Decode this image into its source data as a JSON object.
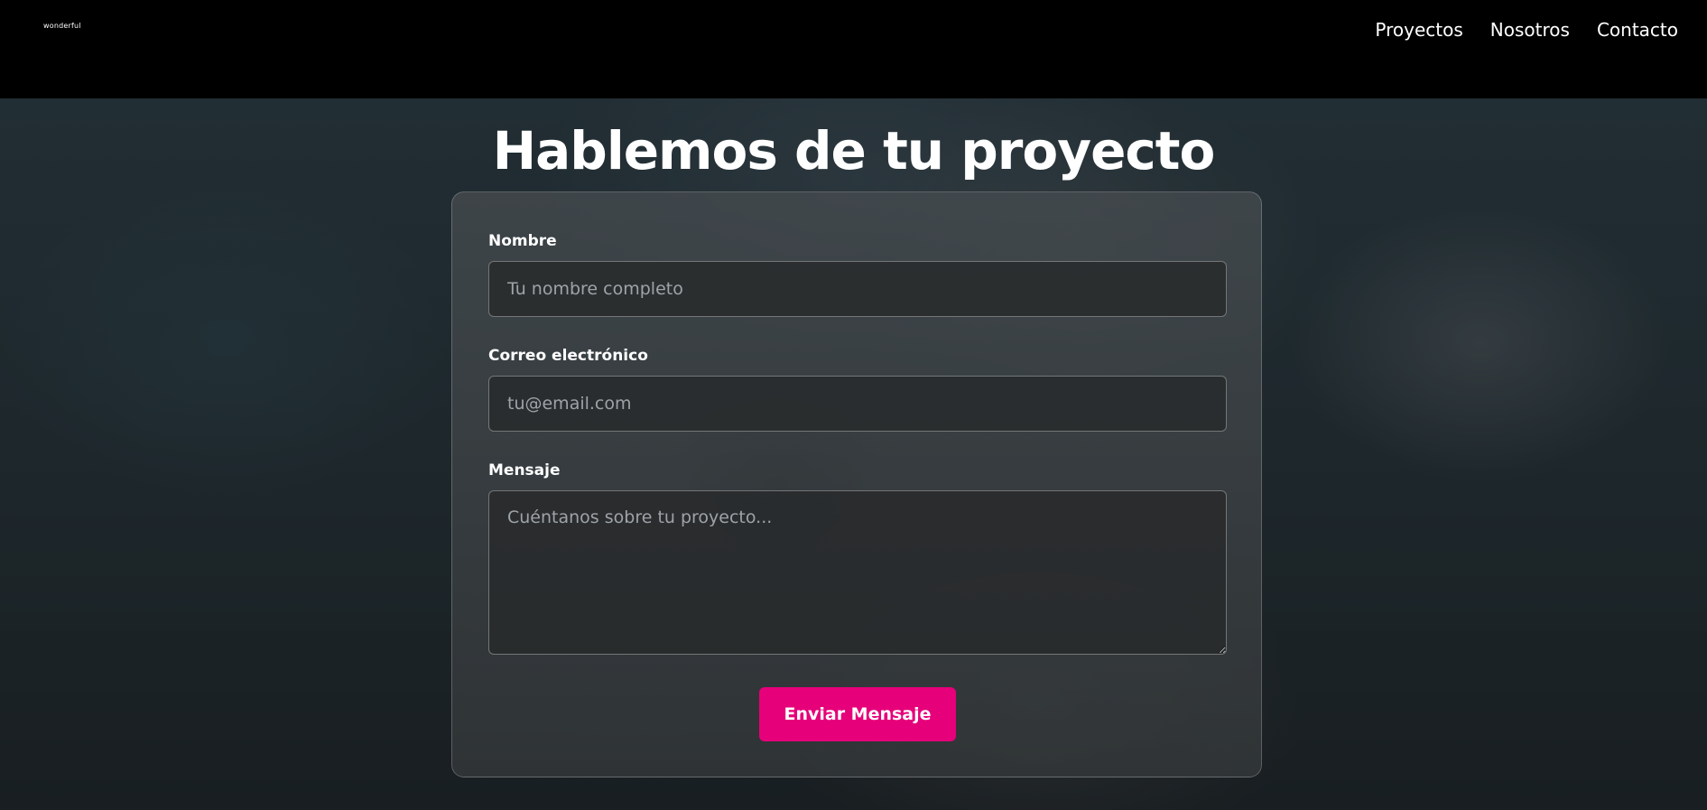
{
  "header": {
    "logo_text": "wonderful",
    "nav": [
      {
        "label": "Proyectos"
      },
      {
        "label": "Nosotros"
      },
      {
        "label": "Contacto"
      }
    ]
  },
  "main": {
    "title": "Hablemos de tu proyecto",
    "form": {
      "name_label": "Nombre",
      "name_placeholder": "Tu nombre completo",
      "email_label": "Correo electrónico",
      "email_placeholder": "tu@email.com",
      "message_label": "Mensaje",
      "message_placeholder": "Cuéntanos sobre tu proyecto...",
      "submit_label": "Enviar Mensaje"
    }
  },
  "colors": {
    "accent": "#e6007a",
    "header_bg": "#000000"
  }
}
